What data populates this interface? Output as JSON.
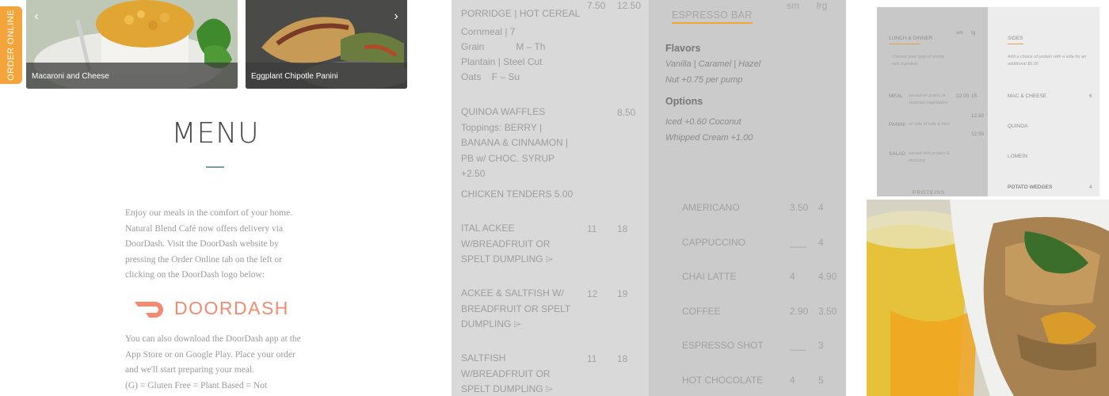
{
  "order_tab": {
    "label": "ORDER ONLINE",
    "color": "#f3a43a"
  },
  "carousel": {
    "slides": [
      {
        "caption": "Macaroni and Cheese"
      },
      {
        "caption": "Eggplant Chipotle Panini"
      }
    ],
    "prev_icon": "chevron-left-icon",
    "next_icon": "chevron-right-icon"
  },
  "intro": {
    "title": "MENU",
    "paragraph1": "Enjoy our meals in the comfort of your home. Natural Blend Café now offers delivery via DoorDash.  Visit the DoorDash website by pressing the Order Online tab on the left or clicking on the DoorDash logo below:",
    "doordash_logo": "DOORDASH",
    "paragraph2": "You can also download the DoorDash app at the App Store or on Google Play.  Place your order and we'll start preparing your meal.",
    "legend": "(G) = Gluten Free    = Plant Based  = Not"
  },
  "breakfast": {
    "col_sm": "",
    "items": [
      {
        "name": "PORRIDGE | HOT CEREAL",
        "sm": "7.50",
        "lrg": "12.50"
      },
      {
        "name": "Cornmeal | 7",
        "sm": "",
        "lrg": ""
      },
      {
        "name": "Grain            M – Th",
        "sm": "",
        "lrg": ""
      },
      {
        "name": "Plantain | Steel Cut",
        "sm": "",
        "lrg": ""
      },
      {
        "name": "Oats    F – Su",
        "sm": "",
        "lrg": ""
      },
      {
        "name": "QUINOA WAFFLES Toppings: BERRY | BANANA & CINNAMON | PB w/ CHOC. SYRUP +2.50",
        "sm": "",
        "lrg": "8.50"
      },
      {
        "name": "CHICKEN TENDERS 5.00",
        "sm": "",
        "lrg": ""
      },
      {
        "name": "ITAL ACKEE W/BREADFRUIT OR SPELT DUMPLING ⌲",
        "sm": "11",
        "lrg": "18"
      },
      {
        "name": "ACKEE & SALTFISH W/ BREADFRUIT OR SPELT DUMPLING ⌲",
        "sm": "12",
        "lrg": "19"
      },
      {
        "name": "SALTFISH W/BREADFRUIT OR SPELT DUMPLING ⌲",
        "sm": "11",
        "lrg": "18"
      }
    ]
  },
  "espresso_bar": {
    "title": "ESPRESSO BAR",
    "col_sm": "sm",
    "col_lrg": "lrg",
    "flavors_head": "Flavors",
    "flavors_text": "Vanilla | Caramel | Hazel Nut +0.75 per pump",
    "options_head": "Options",
    "options_text": "Iced +0.60 Coconut Whipped Cream +1.00",
    "drinks": [
      {
        "name": "AMERICANO",
        "sm": "3.50",
        "lrg": "4"
      },
      {
        "name": "CAPPUCCINO",
        "sm": "___",
        "lrg": "4"
      },
      {
        "name": "CHAI LATTE",
        "sm": "4",
        "lrg": "4.90"
      },
      {
        "name": "COFFEE",
        "sm": "2.90",
        "lrg": "3.50"
      },
      {
        "name": "ESPRESSO SHOT",
        "sm": "___",
        "lrg": "3"
      },
      {
        "name": "HOT CHOCOLATE",
        "sm": "4",
        "lrg": "5"
      }
    ]
  },
  "menu_thumbnail": {
    "lunch_title": "LUNCH & DINNER",
    "col_sm": "sm",
    "col_lg": "lg",
    "lunch_note": "Choose your type of entrée with a protein",
    "meal": "MEAL",
    "meal_note": "served w/ grains or steamed vegetables",
    "meal_sm": "12.00",
    "meal_lg": "15",
    "panini": "PANINI",
    "panini_note": "w/ side of kale & fries",
    "panini_price": "12.50",
    "salad": "SALAD",
    "salad_note": "served with protein & dressing",
    "salad_price": "12.50",
    "proteins": "PROTEINS",
    "sides_title": "SIDES",
    "sides_note": "Add a choice of protein with a side for an additional $5.00",
    "side1": "MAC & CHEESE",
    "side1_price": "6",
    "side2": "QUINOA",
    "side3": "LOMEIN",
    "side4": "POTATO WEDGES",
    "side4_price": "4"
  }
}
